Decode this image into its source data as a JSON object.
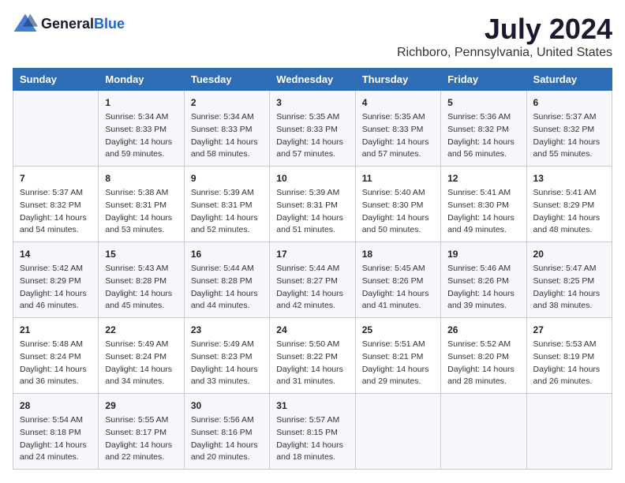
{
  "logo": {
    "general": "General",
    "blue": "Blue"
  },
  "title": "July 2024",
  "subtitle": "Richboro, Pennsylvania, United States",
  "headers": [
    "Sunday",
    "Monday",
    "Tuesday",
    "Wednesday",
    "Thursday",
    "Friday",
    "Saturday"
  ],
  "weeks": [
    [
      {
        "day": "",
        "info": ""
      },
      {
        "day": "1",
        "info": "Sunrise: 5:34 AM\nSunset: 8:33 PM\nDaylight: 14 hours\nand 59 minutes."
      },
      {
        "day": "2",
        "info": "Sunrise: 5:34 AM\nSunset: 8:33 PM\nDaylight: 14 hours\nand 58 minutes."
      },
      {
        "day": "3",
        "info": "Sunrise: 5:35 AM\nSunset: 8:33 PM\nDaylight: 14 hours\nand 57 minutes."
      },
      {
        "day": "4",
        "info": "Sunrise: 5:35 AM\nSunset: 8:33 PM\nDaylight: 14 hours\nand 57 minutes."
      },
      {
        "day": "5",
        "info": "Sunrise: 5:36 AM\nSunset: 8:32 PM\nDaylight: 14 hours\nand 56 minutes."
      },
      {
        "day": "6",
        "info": "Sunrise: 5:37 AM\nSunset: 8:32 PM\nDaylight: 14 hours\nand 55 minutes."
      }
    ],
    [
      {
        "day": "7",
        "info": "Sunrise: 5:37 AM\nSunset: 8:32 PM\nDaylight: 14 hours\nand 54 minutes."
      },
      {
        "day": "8",
        "info": "Sunrise: 5:38 AM\nSunset: 8:31 PM\nDaylight: 14 hours\nand 53 minutes."
      },
      {
        "day": "9",
        "info": "Sunrise: 5:39 AM\nSunset: 8:31 PM\nDaylight: 14 hours\nand 52 minutes."
      },
      {
        "day": "10",
        "info": "Sunrise: 5:39 AM\nSunset: 8:31 PM\nDaylight: 14 hours\nand 51 minutes."
      },
      {
        "day": "11",
        "info": "Sunrise: 5:40 AM\nSunset: 8:30 PM\nDaylight: 14 hours\nand 50 minutes."
      },
      {
        "day": "12",
        "info": "Sunrise: 5:41 AM\nSunset: 8:30 PM\nDaylight: 14 hours\nand 49 minutes."
      },
      {
        "day": "13",
        "info": "Sunrise: 5:41 AM\nSunset: 8:29 PM\nDaylight: 14 hours\nand 48 minutes."
      }
    ],
    [
      {
        "day": "14",
        "info": "Sunrise: 5:42 AM\nSunset: 8:29 PM\nDaylight: 14 hours\nand 46 minutes."
      },
      {
        "day": "15",
        "info": "Sunrise: 5:43 AM\nSunset: 8:28 PM\nDaylight: 14 hours\nand 45 minutes."
      },
      {
        "day": "16",
        "info": "Sunrise: 5:44 AM\nSunset: 8:28 PM\nDaylight: 14 hours\nand 44 minutes."
      },
      {
        "day": "17",
        "info": "Sunrise: 5:44 AM\nSunset: 8:27 PM\nDaylight: 14 hours\nand 42 minutes."
      },
      {
        "day": "18",
        "info": "Sunrise: 5:45 AM\nSunset: 8:26 PM\nDaylight: 14 hours\nand 41 minutes."
      },
      {
        "day": "19",
        "info": "Sunrise: 5:46 AM\nSunset: 8:26 PM\nDaylight: 14 hours\nand 39 minutes."
      },
      {
        "day": "20",
        "info": "Sunrise: 5:47 AM\nSunset: 8:25 PM\nDaylight: 14 hours\nand 38 minutes."
      }
    ],
    [
      {
        "day": "21",
        "info": "Sunrise: 5:48 AM\nSunset: 8:24 PM\nDaylight: 14 hours\nand 36 minutes."
      },
      {
        "day": "22",
        "info": "Sunrise: 5:49 AM\nSunset: 8:24 PM\nDaylight: 14 hours\nand 34 minutes."
      },
      {
        "day": "23",
        "info": "Sunrise: 5:49 AM\nSunset: 8:23 PM\nDaylight: 14 hours\nand 33 minutes."
      },
      {
        "day": "24",
        "info": "Sunrise: 5:50 AM\nSunset: 8:22 PM\nDaylight: 14 hours\nand 31 minutes."
      },
      {
        "day": "25",
        "info": "Sunrise: 5:51 AM\nSunset: 8:21 PM\nDaylight: 14 hours\nand 29 minutes."
      },
      {
        "day": "26",
        "info": "Sunrise: 5:52 AM\nSunset: 8:20 PM\nDaylight: 14 hours\nand 28 minutes."
      },
      {
        "day": "27",
        "info": "Sunrise: 5:53 AM\nSunset: 8:19 PM\nDaylight: 14 hours\nand 26 minutes."
      }
    ],
    [
      {
        "day": "28",
        "info": "Sunrise: 5:54 AM\nSunset: 8:18 PM\nDaylight: 14 hours\nand 24 minutes."
      },
      {
        "day": "29",
        "info": "Sunrise: 5:55 AM\nSunset: 8:17 PM\nDaylight: 14 hours\nand 22 minutes."
      },
      {
        "day": "30",
        "info": "Sunrise: 5:56 AM\nSunset: 8:16 PM\nDaylight: 14 hours\nand 20 minutes."
      },
      {
        "day": "31",
        "info": "Sunrise: 5:57 AM\nSunset: 8:15 PM\nDaylight: 14 hours\nand 18 minutes."
      },
      {
        "day": "",
        "info": ""
      },
      {
        "day": "",
        "info": ""
      },
      {
        "day": "",
        "info": ""
      }
    ]
  ]
}
